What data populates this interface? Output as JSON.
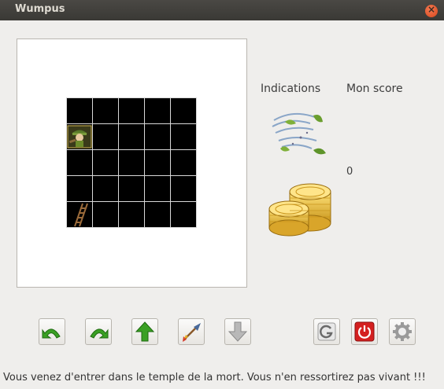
{
  "window": {
    "title": "Wumpus",
    "close_symbol": "×"
  },
  "indications": {
    "label": "Indications",
    "icons": [
      "wind-icon",
      "gold-coins-icon"
    ]
  },
  "score": {
    "label": "Mon score",
    "value": "0"
  },
  "board": {
    "rows": 5,
    "cols": 5,
    "hunter": {
      "row": 2,
      "col": 1
    },
    "ladder": {
      "row": 5,
      "col": 1
    }
  },
  "toolbar": {
    "turn_left": "turn-left-icon",
    "turn_right": "turn-right-icon",
    "move_forward": "arrow-up-icon",
    "shoot_arrow": "arrow-shoot-icon",
    "climb_out": "arrow-down-icon",
    "restart": "restart-icon",
    "quit": "power-icon",
    "settings": "gear-icon"
  },
  "status": {
    "message": "Vous venez d'entrer dans le temple de la mort. Vous n'en ressortirez pas vivant !!!"
  },
  "colors": {
    "accent_green": "#3aa024",
    "quit_red": "#d42020",
    "titlebar": "#3c3b37"
  }
}
